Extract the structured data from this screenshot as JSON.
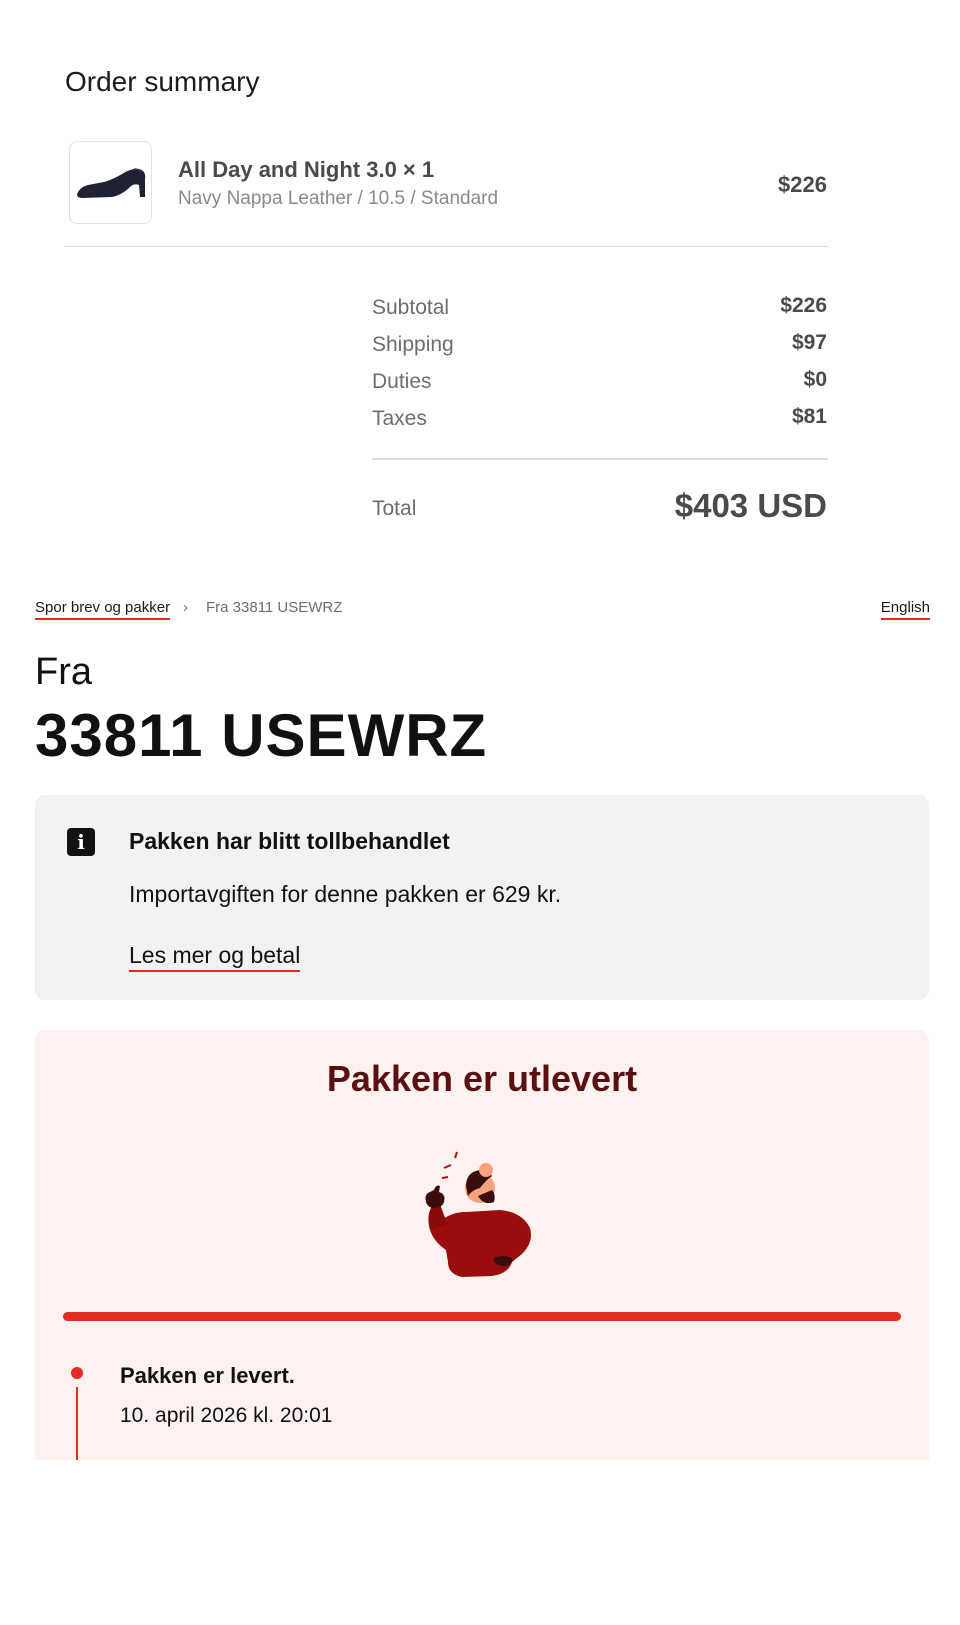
{
  "order_summary": {
    "title": "Order summary",
    "product": {
      "name": "All Day and Night 3.0 × 1",
      "variant": "Navy Nappa Leather / 10.5 / Standard",
      "price": "$226",
      "image_icon": "shoe-thumbnail-icon"
    },
    "lines": [
      {
        "label": "Subtotal",
        "value": "$226"
      },
      {
        "label": "Shipping",
        "value": "$97"
      },
      {
        "label": "Duties",
        "value": "$0"
      },
      {
        "label": "Taxes",
        "value": "$81"
      }
    ],
    "total": {
      "label": "Total",
      "value": "$403 USD"
    }
  },
  "tracking": {
    "breadcrumb": {
      "link": "Spor brev og pakker",
      "separator": "›",
      "current": "Fra 33811 USEWRZ"
    },
    "language_link": "English",
    "from_label": "Fra",
    "number": "33811 USEWRZ",
    "notice": {
      "icon": "info-icon",
      "title": "Pakken har blitt tollbehandlet",
      "text": "Importavgiften for denne pakken er 629 kr.",
      "link": "Les mer og betal"
    },
    "status": {
      "title": "Pakken er utlevert",
      "progress": 1.0,
      "events": [
        {
          "title": "Pakken er levert.",
          "time": "10. april 2026 kl. 20:01"
        }
      ]
    }
  },
  "colors": {
    "accent_red": "#e32d22",
    "status_title": "#5a1010",
    "info_bg": "#f2f2f2",
    "status_bg": "#fdf2f0"
  }
}
